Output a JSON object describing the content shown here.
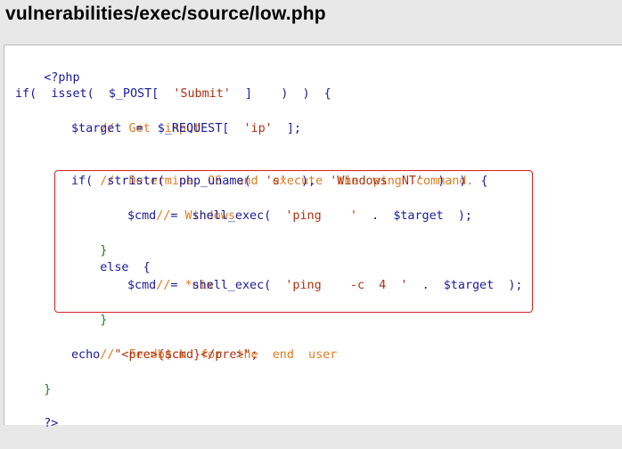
{
  "page": {
    "title": "vulnerabilities/exec/source/low.php",
    "highlight_color": "#d92020"
  },
  "code": {
    "php_open": "<?php",
    "l_if_kw": "if(",
    "l_isset": "isset(",
    "l_post": "$_POST[",
    "l_submit": "'Submit'",
    "l_close": "]    )  )  {",
    "c_get_input": "//  Get  input",
    "l_target": "$target",
    "l_eq": "=",
    "l_request": "$_REQUEST[",
    "l_ip": "'ip'",
    "l_req_close": "];",
    "c_determine": "//  Determine  OS  and  execute  the  ping  command.",
    "l_if2": "if(",
    "l_stristr": "stristr(",
    "l_uname": "php_uname(",
    "l_s": "'s'",
    "l_mid": "),",
    "l_winnt": "'Windows  NT'",
    "l_if2_close": ")  )  {",
    "c_windows": "//  Windows",
    "l_cmd": "$cmd",
    "l_eq2": "=",
    "l_shell": "shell_exec(",
    "l_ping": "'ping    '",
    "l_dot": ".",
    "l_target2": "$target",
    "l_end1": ");",
    "l_brace_close1": "}",
    "l_else": "else  {",
    "c_nix": "//  *nix",
    "l_cmd2": "$cmd",
    "l_eq3": "=",
    "l_shell2": "shell_exec(",
    "l_ping_c": "'ping    -c  4  '",
    "l_dot2": ".",
    "l_target3": "$target",
    "l_end2": ");",
    "l_brace_close2": "}",
    "c_feedback": "//  Feedback  for  the  end  user",
    "l_echo": "echo",
    "l_pre": "\"<pre>{$cmd}</pre>\";",
    "l_brace_close3": "}",
    "php_close": "?>"
  }
}
